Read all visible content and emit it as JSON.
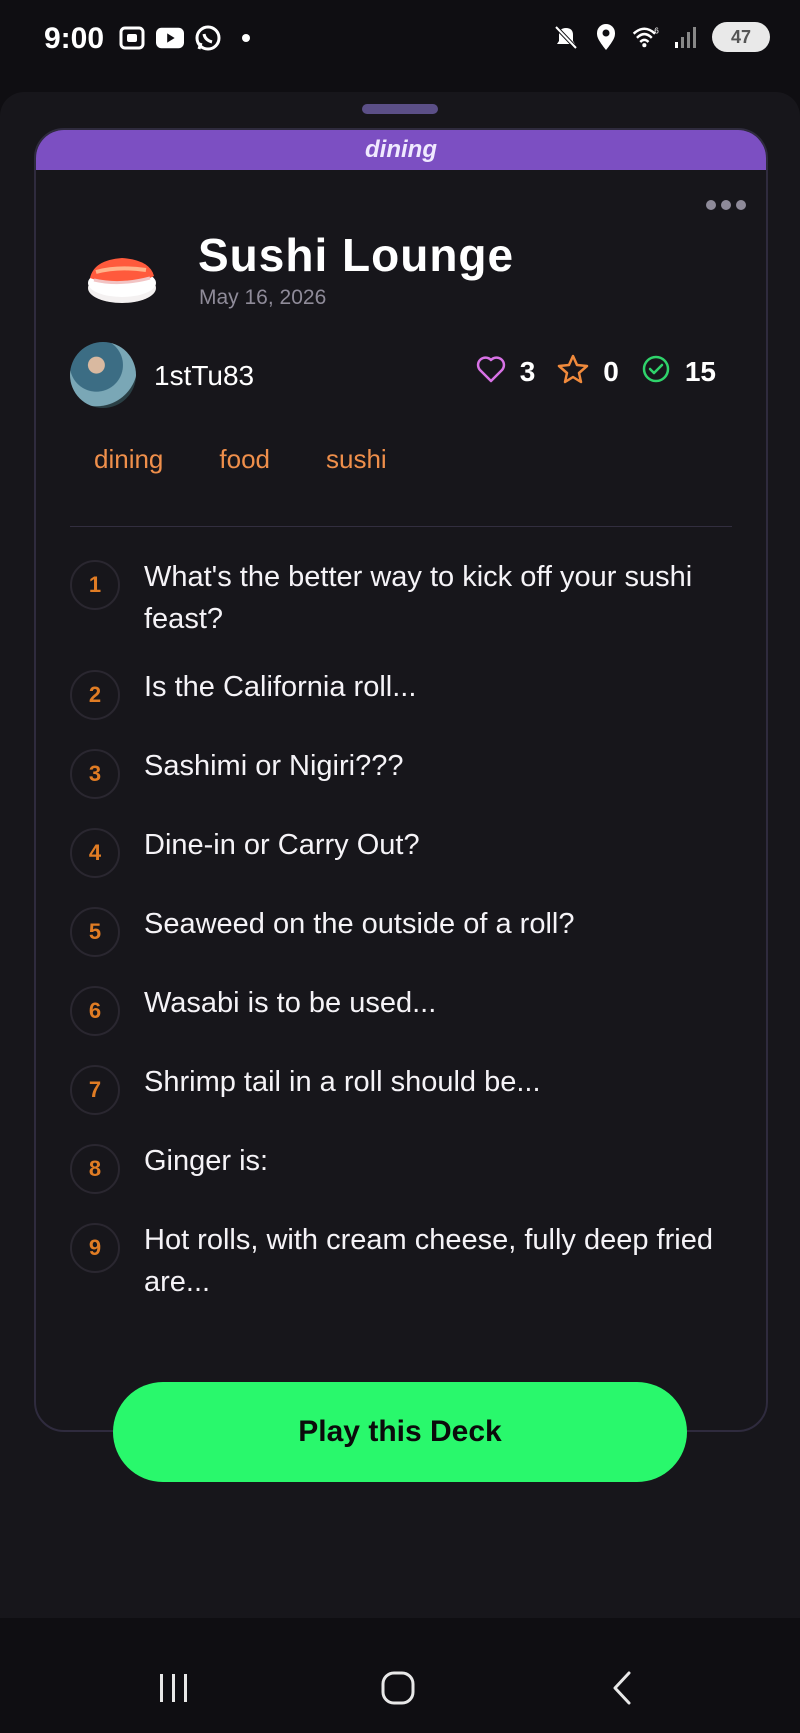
{
  "status_bar": {
    "time": "9:00",
    "battery": "47",
    "left_icons": [
      "screen-record-icon",
      "youtube-icon",
      "whatsapp-icon",
      "dot-icon"
    ],
    "right_icons": [
      "mute-icon",
      "location-icon",
      "wifi-icon",
      "signal-icon",
      "battery-icon"
    ]
  },
  "card": {
    "banner": "dining",
    "emoji": "sushi-icon",
    "title": "Sushi Lounge",
    "date": "May 16, 2026",
    "author": "1stTu83",
    "stats": {
      "likes": "3",
      "stars": "0",
      "completed": "15"
    },
    "tags": [
      "dining",
      "food",
      "sushi"
    ],
    "questions": [
      {
        "num": "1",
        "text": "What's the better way to kick off your sushi feast?"
      },
      {
        "num": "2",
        "text": "Is the California roll..."
      },
      {
        "num": "3",
        "text": "Sashimi or Nigiri???"
      },
      {
        "num": "4",
        "text": "Dine-in or Carry Out?"
      },
      {
        "num": "5",
        "text": "Seaweed on the outside of a roll?"
      },
      {
        "num": "6",
        "text": "Wasabi is to be used..."
      },
      {
        "num": "7",
        "text": "Shrimp tail in a roll should be..."
      },
      {
        "num": "8",
        "text": "Ginger is:"
      },
      {
        "num": "9",
        "text": "Hot rolls, with cream cheese, fully deep fried are..."
      }
    ]
  },
  "actions": {
    "play_label": "Play this Deck"
  },
  "colors": {
    "banner": "#7c4fc2",
    "tag": "#ef8f4b",
    "number": "#e07c24",
    "play_button": "#29f86c",
    "like": "#d872e6",
    "star": "#f08a3c",
    "check": "#2fd36b"
  }
}
